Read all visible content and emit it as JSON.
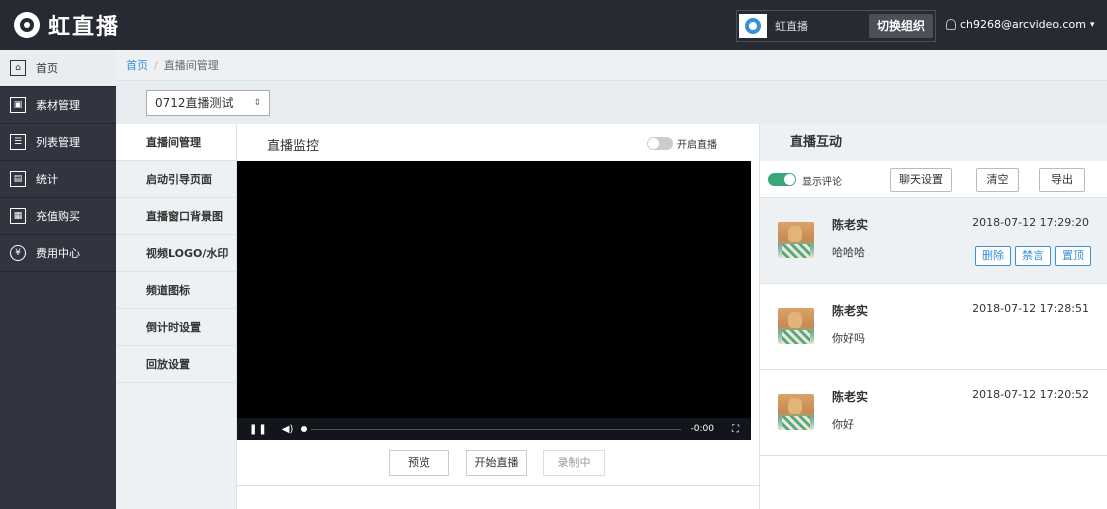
{
  "app": {
    "title": "虹直播"
  },
  "org": {
    "name": "虹直播",
    "switch_label": "切换组织"
  },
  "user": {
    "email": "ch9268@arcvideo.com",
    "caret": "▾"
  },
  "sidebar": {
    "items": [
      {
        "label": "首页",
        "icon": "home-icon",
        "glyph": "⌂"
      },
      {
        "label": "素材管理",
        "icon": "media-icon",
        "glyph": "▣"
      },
      {
        "label": "列表管理",
        "icon": "list-icon",
        "glyph": "☰"
      },
      {
        "label": "统计",
        "icon": "chart-icon",
        "glyph": "▤"
      },
      {
        "label": "充值购买",
        "icon": "calculator-icon",
        "glyph": "▦"
      },
      {
        "label": "费用中心",
        "icon": "yen-icon",
        "glyph": "¥"
      }
    ]
  },
  "breadcrumb": {
    "home": "首页",
    "separator": "/",
    "current": "直播间管理"
  },
  "room_select": {
    "value": "0712直播测试",
    "arrow": "⇕"
  },
  "subnav": {
    "items": [
      "直播间管理",
      "启动引导页面",
      "直播窗口背景图",
      "视频LOGO/水印",
      "频道图标",
      "倒计时设置",
      "回放设置"
    ]
  },
  "monitor": {
    "title": "直播监控",
    "toggle_label": "开启直播",
    "player": {
      "pause": "❚❚",
      "volume": "◀)",
      "time": "-0:00",
      "fullscreen": "⛶"
    },
    "buttons": {
      "preview": "预览",
      "start": "开始直播",
      "recording": "录制中"
    }
  },
  "interaction": {
    "title": "直播互动",
    "show_comments_label": "显示评论",
    "buttons": {
      "chat_settings": "聊天设置",
      "clear": "清空",
      "export": "导出"
    },
    "comments": [
      {
        "name": "陈老实",
        "time": "2018-07-12 17:29:20",
        "text": "哈哈哈",
        "actions": [
          "删除",
          "禁言",
          "置顶"
        ]
      },
      {
        "name": "陈老实",
        "time": "2018-07-12 17:28:51",
        "text": "你好吗"
      },
      {
        "name": "陈老实",
        "time": "2018-07-12 17:20:52",
        "text": "你好"
      }
    ]
  },
  "colors": {
    "topbar": "#262a33",
    "sidebar": "#303540",
    "accent": "#3a8fd6",
    "toggle_on": "#3aa67a"
  }
}
